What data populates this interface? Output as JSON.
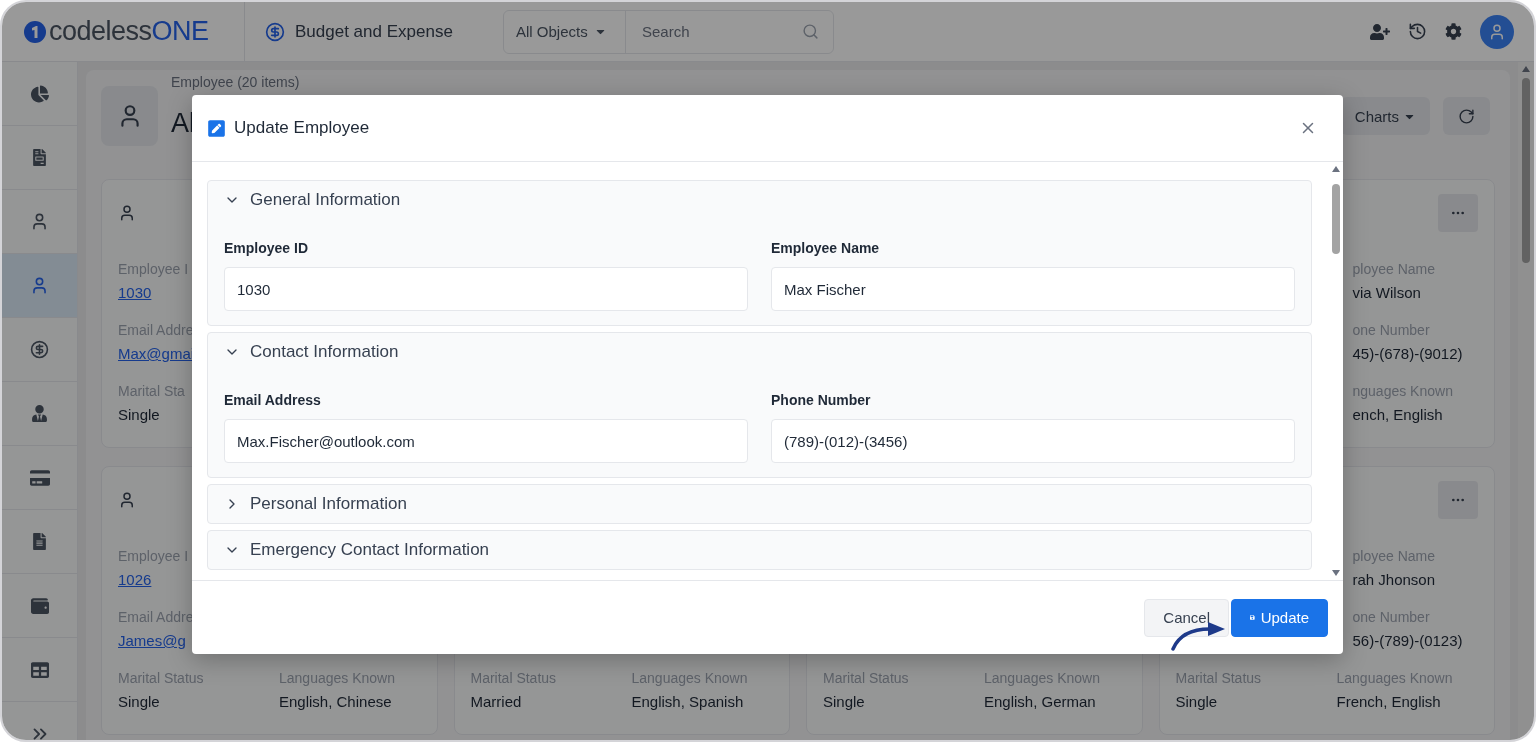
{
  "topbar": {
    "logo_text": "codeless",
    "logo_accent": "ONE",
    "app_name": "Budget and Expense",
    "search_scope": "All Objects",
    "search_placeholder": "Search"
  },
  "sidebar": {
    "items": [
      {
        "kind": "pie-chart",
        "selected": false
      },
      {
        "kind": "spreadsheet",
        "selected": false
      },
      {
        "kind": "user",
        "selected": false
      },
      {
        "kind": "user",
        "selected": true
      },
      {
        "kind": "dollar",
        "selected": false
      },
      {
        "kind": "user-tie",
        "selected": false
      },
      {
        "kind": "card",
        "selected": false
      },
      {
        "kind": "document",
        "selected": false
      },
      {
        "kind": "wallet",
        "selected": false
      },
      {
        "kind": "table",
        "selected": false
      }
    ]
  },
  "page_header": {
    "subtitle": "Employee (20 items)",
    "title": "Al",
    "charts_button": "Charts"
  },
  "card_rows": [
    [
      {
        "avatar": true,
        "rows": [
          {
            "left": {
              "label": "Employee I",
              "value": "1030",
              "kind": "link"
            }
          },
          {
            "left": {
              "label": "Email Addre",
              "value": "Max@gmai",
              "kind": "link"
            }
          },
          {
            "left": {
              "label": "Marital Sta",
              "value": "Single",
              "kind": "text"
            }
          }
        ]
      },
      {
        "menu": true,
        "rows": [
          {
            "right": {
              "label": "ployee Name",
              "value": "via Wilson",
              "kind": "text",
              "cut": true
            }
          },
          {
            "right": {
              "label": "one Number",
              "value": "45)-(678)-(9012)",
              "kind": "text",
              "cut": true
            }
          },
          {
            "right": {
              "label": "nguages Known",
              "value": "ench, English",
              "kind": "text",
              "cut": true
            }
          }
        ]
      }
    ],
    [
      {
        "avatar": true,
        "rows": [
          {
            "left": {
              "label": "Employee I",
              "value": "1026",
              "kind": "link"
            }
          },
          {
            "left": {
              "label": "Email Addre",
              "value": "James@g",
              "kind": "link"
            }
          },
          {
            "left": {
              "label": "Marital Status",
              "value": "Single",
              "kind": "text"
            },
            "right": {
              "label": "Languages Known",
              "value": "English, Chinese",
              "kind": "text"
            }
          }
        ]
      },
      {
        "rows": [
          {
            "left": {
              "label": "Marital Status",
              "value": "Married",
              "kind": "text"
            },
            "right": {
              "label": "Languages Known",
              "value": "English, Spanish",
              "kind": "text"
            }
          }
        ]
      },
      {
        "rows": [
          {
            "left": {
              "label": "Marital Status",
              "value": "Single",
              "kind": "text"
            },
            "right": {
              "label": "Languages Known",
              "value": "English, German",
              "kind": "text"
            }
          }
        ]
      },
      {
        "menu": true,
        "rows": [
          {
            "right": {
              "label": "ployee Name",
              "value": "rah Jhonson",
              "kind": "text",
              "cut": true
            }
          },
          {
            "right": {
              "label": "one Number",
              "value": "56)-(789)-(0123)",
              "kind": "text",
              "cut": true
            }
          },
          {
            "left": {
              "label": "Marital Status",
              "value": "Single",
              "kind": "text"
            },
            "right": {
              "label": "Languages Known",
              "value": "French, English",
              "kind": "text"
            }
          }
        ]
      }
    ]
  ],
  "modal": {
    "title": "Update Employee",
    "sections": [
      {
        "title": "General Information",
        "expanded": true,
        "fields": [
          {
            "label": "Employee ID",
            "value": "1030"
          },
          {
            "label": "Employee Name",
            "value": "Max Fischer"
          }
        ]
      },
      {
        "title": "Contact Information",
        "expanded": true,
        "fields": [
          {
            "label": "Email Address",
            "value": "Max.Fischer@outlook.com"
          },
          {
            "label": "Phone Number",
            "value": "(789)-(012)-(3456)"
          }
        ]
      },
      {
        "title": "Personal Information",
        "expanded": false
      },
      {
        "title": "Emergency Contact Information",
        "expanded": true
      }
    ],
    "buttons": [
      {
        "label": "Cancel",
        "kind": "secondary"
      },
      {
        "label": "Update",
        "kind": "primary"
      }
    ]
  }
}
